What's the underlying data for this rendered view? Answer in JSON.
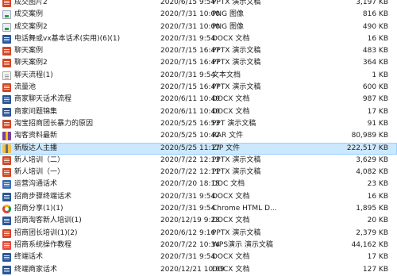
{
  "files": [
    {
      "name": "成交图片2",
      "date": "2020/6/15 9:54",
      "type": "PPTX 演示文稿",
      "size": "3,197 KB",
      "icon": "pptx"
    },
    {
      "name": "成交案例",
      "date": "2020/7/31 10:00",
      "type": "PNG 图像",
      "size": "816 KB",
      "icon": "png"
    },
    {
      "name": "成交案例2",
      "date": "2020/7/31 10:00",
      "type": "PNG 图像",
      "size": "490 KB",
      "icon": "png"
    },
    {
      "name": "电话舞或vx基本话术(实用)(6)(1)",
      "date": "2020/7/31 9:54",
      "type": "DOCX 文档",
      "size": "16 KB",
      "icon": "docx"
    },
    {
      "name": "聊天案例",
      "date": "2020/7/15 16:47",
      "type": "PPTX 演示文稿",
      "size": "483 KB",
      "icon": "pptx"
    },
    {
      "name": "聊天案例2",
      "date": "2020/7/15 16:47",
      "type": "PPTX 演示文稿",
      "size": "364 KB",
      "icon": "pptx"
    },
    {
      "name": "聊天流程(1)",
      "date": "2020/7/31 9:54",
      "type": "文本文档",
      "size": "1 KB",
      "icon": "txt"
    },
    {
      "name": "流量池",
      "date": "2020/7/15 16:47",
      "type": "PPTX 演示文稿",
      "size": "600 KB",
      "icon": "pptx"
    },
    {
      "name": "商家聊天话术流程",
      "date": "2020/6/11 10:40",
      "type": "DOCX 文档",
      "size": "987 KB",
      "icon": "docx"
    },
    {
      "name": "商家问题锦集",
      "date": "2020/6/11 10:40",
      "type": "DOCX 文档",
      "size": "17 KB",
      "icon": "docx"
    },
    {
      "name": "淘宝招商团长暴力的原因",
      "date": "2020/5/25 16:53",
      "type": "PPT 演示文稿",
      "size": "91 KB",
      "icon": "pptx"
    },
    {
      "name": "淘客资料最新",
      "date": "2020/5/25 10:42",
      "type": "RAR 文件",
      "size": "80,989 KB",
      "icon": "rar"
    },
    {
      "name": "新版达人主播",
      "date": "2020/5/25 11:17",
      "type": "ZIP 文件",
      "size": "222,517 KB",
      "icon": "zip",
      "selected": true
    },
    {
      "name": "新人培训（二）",
      "date": "2020/7/22 12:13",
      "type": "PPTX 演示文稿",
      "size": "3,629 KB",
      "icon": "pptx"
    },
    {
      "name": "新人培训（一）",
      "date": "2020/7/22 12:11",
      "type": "PPTX 演示文稿",
      "size": "4,082 KB",
      "icon": "pptx"
    },
    {
      "name": "运营沟通话术",
      "date": "2020/7/20 18:15",
      "type": "DOC 文档",
      "size": "23 KB",
      "icon": "doc"
    },
    {
      "name": "招商步骤终端话术",
      "date": "2020/7/31 9:54",
      "type": "DOCX 文档",
      "size": "16 KB",
      "icon": "docx"
    },
    {
      "name": "招商分享(1)(1)",
      "date": "2020/7/31 9:54",
      "type": "Chrome HTML D...",
      "size": "1,895 KB",
      "icon": "chrome"
    },
    {
      "name": "招商淘客新人培训(1)",
      "date": "2020/12/19 9:23",
      "type": "DOCX 文档",
      "size": "20 KB",
      "icon": "docx"
    },
    {
      "name": "招商团长培训(1)(2)",
      "date": "2020/6/12 9:16",
      "type": "PPTX 演示文稿",
      "size": "2,379 KB",
      "icon": "pptx"
    },
    {
      "name": "招商系统操作教程",
      "date": "2020/7/22 10:34",
      "type": "WPS演示 演示文稿",
      "size": "44,162 KB",
      "icon": "wps"
    },
    {
      "name": "终端话术",
      "date": "2020/7/31 9:54",
      "type": "DOCX 文档",
      "size": "17 KB",
      "icon": "docx"
    },
    {
      "name": "终端商家话术",
      "date": "2020/12/21 10:09",
      "type": "DOCX 文档",
      "size": "127 KB",
      "icon": "docx"
    }
  ]
}
